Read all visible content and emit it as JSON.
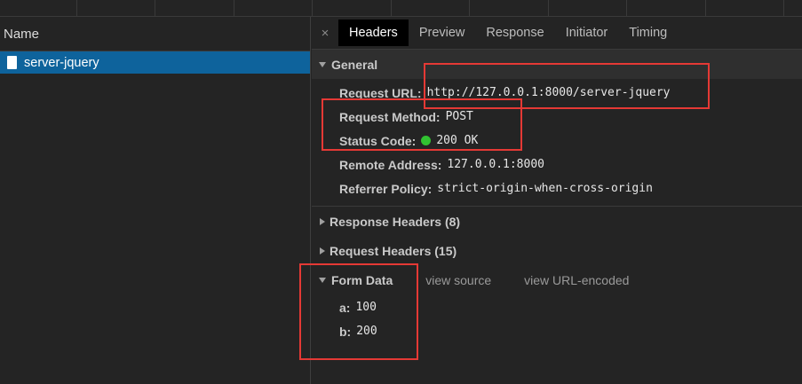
{
  "left": {
    "column_header": "Name",
    "requests": [
      {
        "name": "server-jquery",
        "selected": true
      }
    ]
  },
  "tabs": [
    "Headers",
    "Preview",
    "Response",
    "Initiator",
    "Timing"
  ],
  "active_tab": "Headers",
  "close_icon": "×",
  "general": {
    "title": "General",
    "rows": [
      {
        "key": "Request URL:",
        "value": "http://127.0.0.1:8000/server-jquery"
      },
      {
        "key": "Request Method:",
        "value": "POST"
      },
      {
        "key": "Status Code:",
        "value": "200 OK",
        "status_color": "#31c231"
      },
      {
        "key": "Remote Address:",
        "value": "127.0.0.1:8000"
      },
      {
        "key": "Referrer Policy:",
        "value": "strict-origin-when-cross-origin"
      }
    ]
  },
  "response_headers": "Response Headers (8)",
  "request_headers": "Request Headers (15)",
  "form_data": {
    "title": "Form Data",
    "view_source": "view source",
    "view_url_encoded": "view URL-encoded",
    "rows": [
      {
        "key": "a:",
        "value": "100"
      },
      {
        "key": "b:",
        "value": "200"
      }
    ]
  },
  "colors": {
    "selected_row": "#0e639c",
    "highlight_box": "#e53935",
    "background": "#242424"
  }
}
